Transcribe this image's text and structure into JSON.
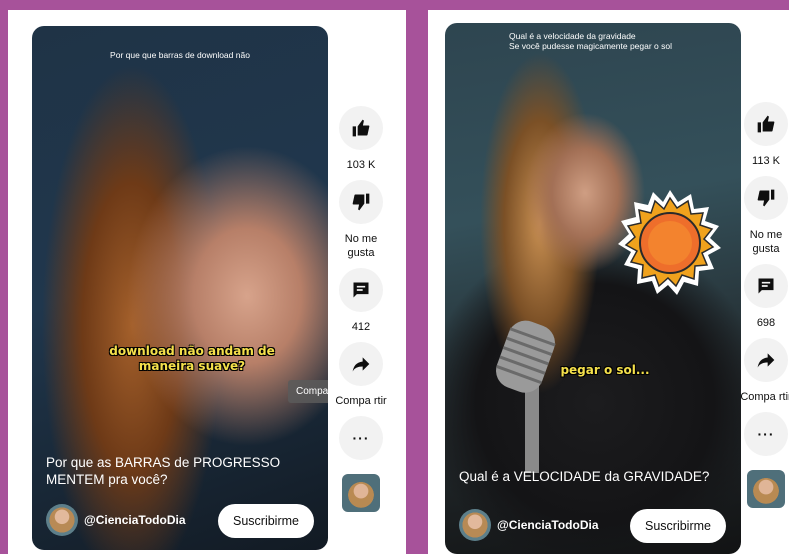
{
  "left": {
    "top_caption": "Por que que barras de download não",
    "subtitle": "download não andam de maneira suave?",
    "tooltip": "Compartir",
    "title": "Por que as BARRAS de PROGRESSO MENTEM pra você?",
    "channel": "@CienciaTodoDia",
    "subscribe": "Suscribirme",
    "likes": "103 K",
    "dislike_label": "No me gusta",
    "comments": "412",
    "share_label": "Compa rtir",
    "more": "···"
  },
  "right": {
    "top_caption_1": "Qual é a velocidade da gravidade",
    "top_caption_2": "Se você pudesse magicamente pegar o sol",
    "subtitle": "pegar o sol...",
    "title": "Qual é a VELOCIDADE da GRAVIDADE?",
    "channel": "@CienciaTodoDia",
    "subscribe": "Suscribirme",
    "likes": "113 K",
    "dislike_label": "No me gusta",
    "comments": "698",
    "share_label": "Compa rtir",
    "more": "···"
  },
  "icons": [
    "thumbs-up-icon",
    "thumbs-down-icon",
    "comment-icon",
    "share-arrow-icon",
    "more-dots-icon",
    "sun-sticker-icon"
  ],
  "colors": {
    "background": "#a7529a",
    "subtitle": "#f4e04b",
    "button_bg": "#f2f2f2"
  }
}
